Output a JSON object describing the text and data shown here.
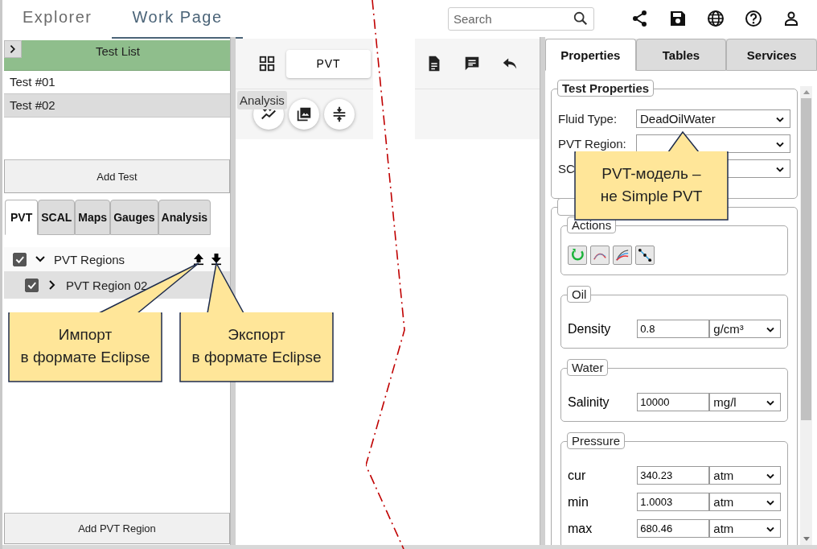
{
  "top_bar": {
    "tabs": [
      {
        "label": "Explorer",
        "selected": false
      },
      {
        "label": "Work Page",
        "selected": true
      }
    ],
    "search": {
      "placeholder": "Search"
    }
  },
  "test_list": {
    "title": "Test List",
    "items": [
      {
        "label": "Test #01",
        "selected": false
      },
      {
        "label": "Test #02",
        "selected": true
      }
    ],
    "add_button": "Add Test"
  },
  "left_tabs": [
    {
      "label": "PVT",
      "selected": true
    },
    {
      "label": "SCAL",
      "selected": false
    },
    {
      "label": "Maps",
      "selected": false
    },
    {
      "label": "Gauges",
      "selected": false
    },
    {
      "label": "Analysis",
      "selected": false
    }
  ],
  "tree": [
    {
      "label": "PVT Regions",
      "checked": true,
      "expanded": true,
      "selected": false,
      "children": [
        {
          "label": "PVT Region 02",
          "checked": true,
          "expanded": false,
          "selected": true
        }
      ]
    }
  ],
  "add_region_button": "Add PVT Region",
  "middle_toolbar": {
    "tab": "PVT",
    "tooltip": "Analysis"
  },
  "right_tabs": [
    {
      "label": "Properties",
      "selected": true
    },
    {
      "label": "Tables",
      "selected": false
    },
    {
      "label": "Services",
      "selected": false
    }
  ],
  "test_properties": {
    "title": "Test Properties",
    "fields": [
      {
        "label": "Fluid Type:",
        "value": "DeadOilWater"
      },
      {
        "label": "PVT Region:"
      },
      {
        "label": "SC"
      }
    ]
  },
  "region_properties": {
    "actions_title": "Actions",
    "groups": [
      {
        "title": "Oil",
        "rows": [
          {
            "label": "Density",
            "value": "0.8",
            "unit": "g/cm³"
          }
        ]
      },
      {
        "title": "Water",
        "rows": [
          {
            "label": "Salinity",
            "value": "10000",
            "unit": "mg/l"
          }
        ]
      },
      {
        "title": "Pressure",
        "rows": [
          {
            "label": "cur",
            "value": "340.23",
            "unit": "atm"
          },
          {
            "label": "min",
            "value": "1.0003",
            "unit": "atm"
          },
          {
            "label": "max",
            "value": "680.46",
            "unit": "atm"
          }
        ]
      }
    ]
  },
  "callouts": [
    {
      "text": "Импорт\nв формате Eclipse"
    },
    {
      "text": "Экспорт\nв формате Eclipse"
    },
    {
      "text": "PVT-модель –\nне Simple PVT"
    }
  ]
}
